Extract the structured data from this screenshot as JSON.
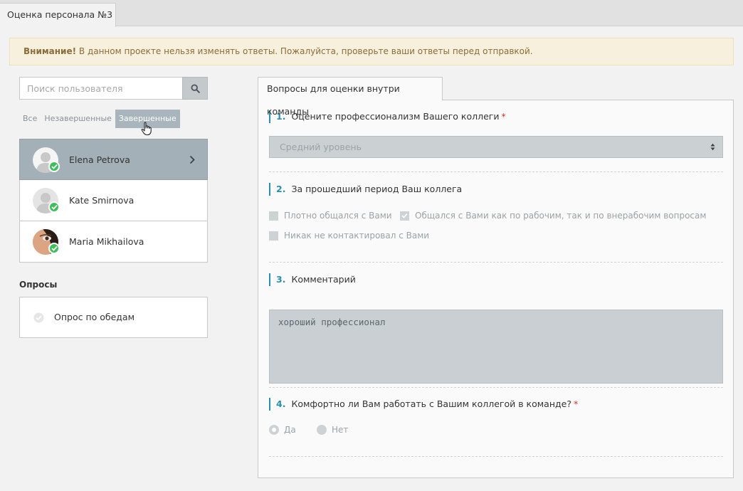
{
  "app": {
    "tab_title": "Оценка персонала №3"
  },
  "alert": {
    "strong": "Внимание!",
    "text": "В данном проекте нельзя изменять ответы. Пожалуйста, проверьте ваши ответы перед отправкой."
  },
  "search": {
    "placeholder": "Поиск пользователя",
    "value": "",
    "icon": "search-icon"
  },
  "filters": [
    "Все",
    "Незавершенные",
    "Завершенные"
  ],
  "filters_active": "Завершенные",
  "users": [
    {
      "name": "Elena Petrova",
      "status": "completed",
      "selected": true
    },
    {
      "name": "Kate Smirnova",
      "status": "completed",
      "selected": false
    },
    {
      "name": "Maria Mikhailova",
      "status": "completed",
      "selected": false
    }
  ],
  "polls": {
    "title": "Опросы",
    "items": [
      {
        "name": "Опрос по обедам"
      }
    ]
  },
  "panel": {
    "tab": "Вопросы для оценки внутри команды",
    "questions": [
      {
        "num": "1.",
        "text": "Оцените профессионализм Вашего коллеги",
        "required": "*",
        "select_value": "Средний уровень"
      },
      {
        "num": "2.",
        "text": "За прошедший период Ваш коллега",
        "required": "",
        "options": [
          {
            "label": "Плотно общался с Вами",
            "checked": false
          },
          {
            "label": "Общался с Вами как по рабочим, так и по внерабочим вопросам",
            "checked": true
          },
          {
            "label": "Никак не контактировал с Вами",
            "checked": false
          }
        ]
      },
      {
        "num": "3.",
        "text": "Комментарий",
        "required": "",
        "answer": "хороший профессионал"
      },
      {
        "num": "4.",
        "text": "Комфортно ли Вам работать с Вашим коллегой в команде?",
        "required": "*",
        "options": [
          {
            "label": "Да",
            "selected": true
          },
          {
            "label": "Нет",
            "selected": false
          }
        ]
      }
    ]
  },
  "colors": {
    "accent": "#2a8fb2",
    "required": "#d9302c",
    "success": "#3fbf5c",
    "selected_row": "#a4b0b7"
  }
}
